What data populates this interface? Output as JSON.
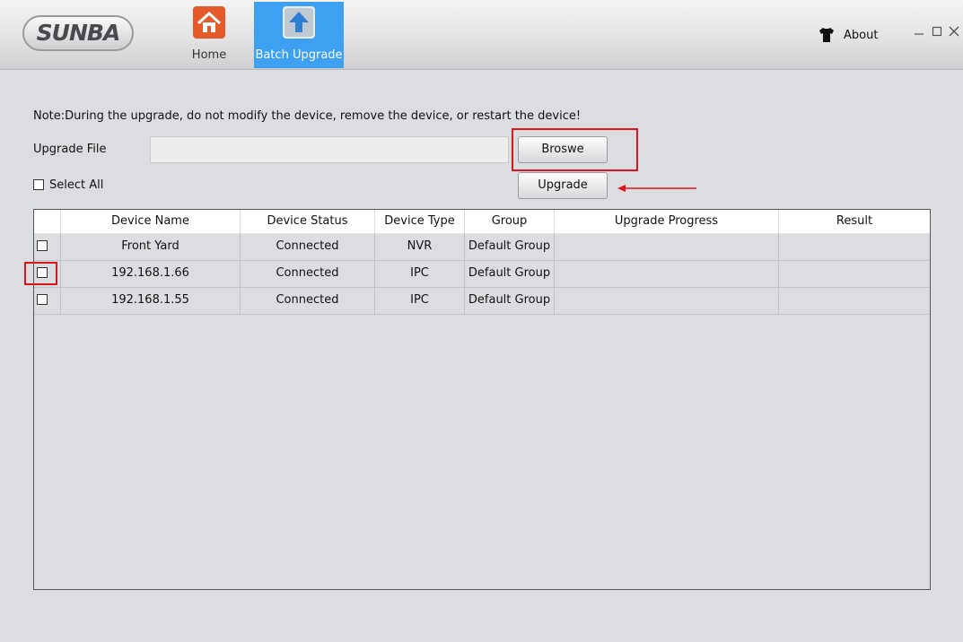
{
  "app": {
    "logo_text": "SUNBA",
    "nav": [
      {
        "label": "Home",
        "icon": "home-icon",
        "icon_color": "#e45a2b",
        "active": false
      },
      {
        "label": "Batch Upgrade",
        "icon": "upgrade-arrow-icon",
        "icon_color": "#2d7fd4",
        "active": true
      }
    ],
    "about_label": "About",
    "window_controls": [
      "minimize",
      "maximize",
      "close"
    ],
    "accent_color": "#3da0f1",
    "highlight_color": "#e2141b"
  },
  "note": "Note:During the upgrade, do not modify the device, remove the device, or restart the device!",
  "upgrade_file": {
    "label": "Upgrade File",
    "value": "",
    "browse_label": "Broswe",
    "upgrade_label": "Upgrade"
  },
  "select_all": {
    "label": "Select All",
    "checked": false
  },
  "table": {
    "columns": [
      "",
      "Device Name",
      "Device Status",
      "Device Type",
      "Group",
      "Upgrade Progress",
      "Result"
    ],
    "rows": [
      {
        "checked": false,
        "name": "Front Yard",
        "status": "Connected",
        "type": "NVR",
        "group": "Default Group",
        "progress": "",
        "result": ""
      },
      {
        "checked": false,
        "name": "192.168.1.66",
        "status": "Connected",
        "type": "IPC",
        "group": "Default Group",
        "progress": "",
        "result": ""
      },
      {
        "checked": false,
        "name": "192.168.1.55",
        "status": "Connected",
        "type": "IPC",
        "group": "Default Group",
        "progress": "",
        "result": ""
      }
    ]
  }
}
